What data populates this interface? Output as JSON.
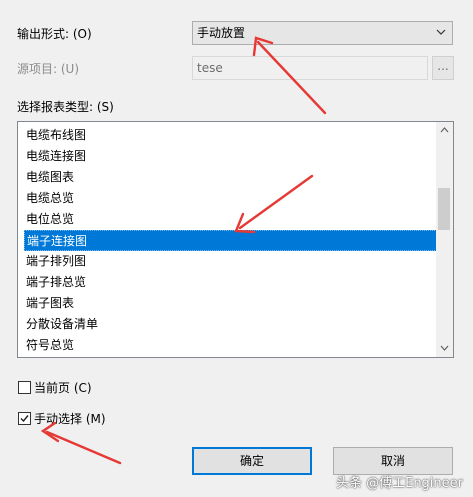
{
  "output_format": {
    "label": "输出形式: (O)",
    "value": "手动放置"
  },
  "source_item": {
    "label": "源项目: (U)",
    "value": "tese",
    "browse_label": "..."
  },
  "report_type": {
    "label": "选择报表类型: (S)",
    "items": [
      "电缆布线图",
      "电缆连接图",
      "电缆图表",
      "电缆总览",
      "电位总览",
      "端子连接图",
      "端子排列图",
      "端子排总览",
      "端子图表",
      "分散设备清单",
      "符号总览"
    ],
    "selected": "端子连接图"
  },
  "current_page": {
    "label": "当前页 (C)",
    "checked": false
  },
  "manual_select": {
    "label": "手动选择 (M)",
    "checked": true
  },
  "buttons": {
    "ok": "确定",
    "cancel": "取消"
  },
  "watermark": "头条 @傅工Engineer",
  "colors": {
    "selection": "#0078d7",
    "annotation_arrow": "#e53935"
  }
}
